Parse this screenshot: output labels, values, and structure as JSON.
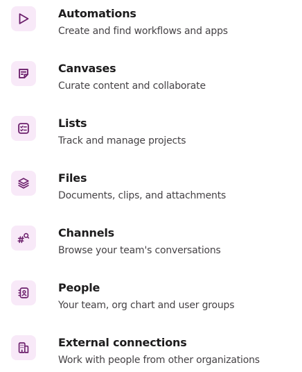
{
  "accent_color": "#6b1f6b",
  "icon_tile_color": "#f8e9f8",
  "items": [
    {
      "icon": "play-triangle-icon",
      "title": "Automations",
      "description": "Create and find workflows and apps"
    },
    {
      "icon": "canvas-note-icon",
      "title": "Canvases",
      "description": "Curate content and collaborate"
    },
    {
      "icon": "checklist-icon",
      "title": "Lists",
      "description": "Track and manage projects"
    },
    {
      "icon": "layers-stack-icon",
      "title": "Files",
      "description": "Documents, clips, and attachments"
    },
    {
      "icon": "channel-search-icon",
      "title": "Channels",
      "description": "Browse your team's conversations"
    },
    {
      "icon": "contact-card-icon",
      "title": "People",
      "description": "Your team, org chart and user groups"
    },
    {
      "icon": "building-icon",
      "title": "External connections",
      "description": "Work with people from other organizations"
    }
  ]
}
